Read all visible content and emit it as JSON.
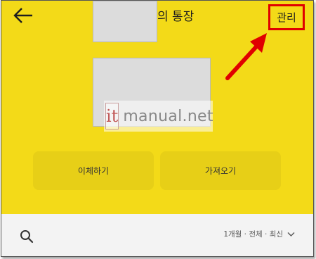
{
  "header": {
    "title_suffix": "의 통장",
    "manage_label": "관리"
  },
  "watermark": {
    "logo": "it",
    "text": "manual.net"
  },
  "actions": {
    "transfer_label": "이체하기",
    "fetch_label": "가져오기"
  },
  "filter_bar": {
    "filter_label": "1개월 · 전체 · 최신"
  },
  "colors": {
    "background_yellow": "#f3da18",
    "button_yellow": "#e7cf17",
    "highlight_red": "#e00000",
    "bottom_bar": "#f3f3f3"
  },
  "icons": {
    "back": "back-arrow-icon",
    "search": "search-icon",
    "filter": "chevron-down-icon",
    "annotation": "red-arrow-icon"
  }
}
